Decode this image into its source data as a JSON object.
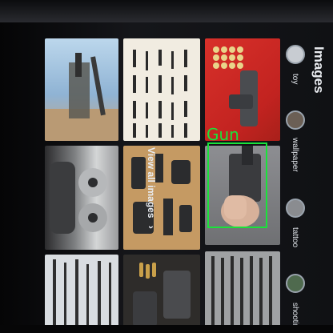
{
  "header": {
    "title": "Images"
  },
  "chips": [
    {
      "label": "toy",
      "icon": "toy-gun-thumbnail-icon"
    },
    {
      "label": "wallpaper",
      "icon": "wallpaper-thumbnail-icon"
    },
    {
      "label": "tattoo",
      "icon": "tattoo-thumbnail-icon"
    },
    {
      "label": "shooting",
      "icon": "shooting-thumbnail-icon"
    }
  ],
  "view_all": {
    "label": "View all images",
    "chevron": "›"
  },
  "detection": {
    "label": "Gun",
    "color": "#19e33a"
  },
  "colors": {
    "background": "#0a0a0c",
    "text": "#e9ecf0"
  }
}
